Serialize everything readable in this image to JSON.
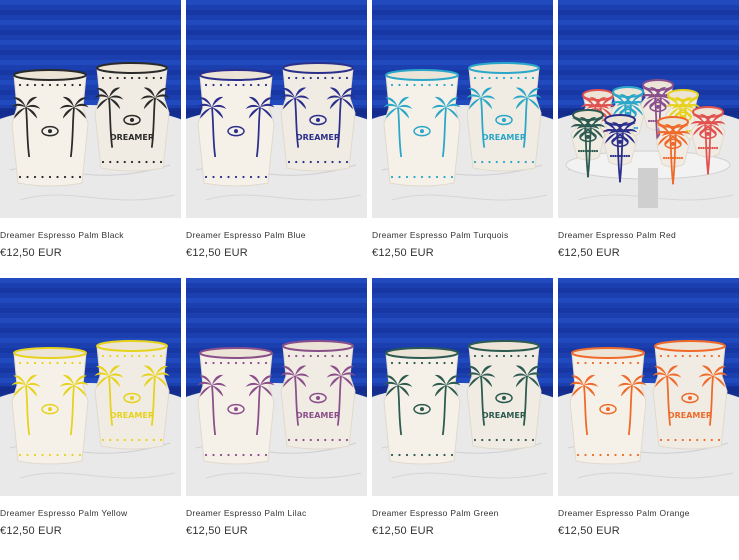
{
  "products": [
    {
      "title": "Dreamer Espresso Palm Black",
      "price": "€12,50 EUR",
      "accent": "#2a2a2a"
    },
    {
      "title": "Dreamer Espresso Palm Blue",
      "price": "€12,50 EUR",
      "accent": "#2b2f8c"
    },
    {
      "title": "Dreamer Espresso Palm Turquois",
      "price": "€12,50 EUR",
      "accent": "#2aa6c8"
    },
    {
      "title": "Dreamer Espresso Palm Red",
      "price": "€12,50 EUR",
      "accent": "#e0524f"
    },
    {
      "title": "Dreamer Espresso Palm Yellow",
      "price": "€12,50 EUR",
      "accent": "#e6d21c"
    },
    {
      "title": "Dreamer Espresso Palm Lilac",
      "price": "€12,50 EUR",
      "accent": "#8a4f8a"
    },
    {
      "title": "Dreamer Espresso Palm Green",
      "price": "€12,50 EUR",
      "accent": "#2c5a50"
    },
    {
      "title": "Dreamer Espresso Palm Orange",
      "price": "€12,50 EUR",
      "accent": "#ef6a2a"
    }
  ],
  "cup_text": "DREAMER"
}
